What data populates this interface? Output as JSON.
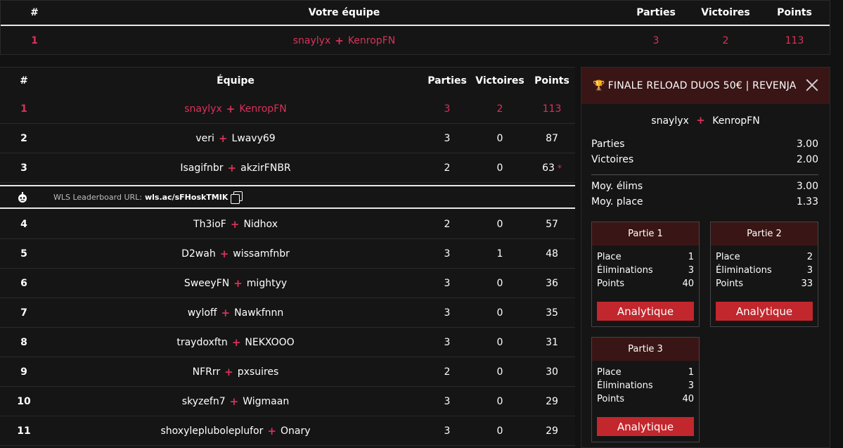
{
  "my_team": {
    "headers": {
      "rank": "#",
      "team": "Votre équipe",
      "games": "Parties",
      "wins": "Victoires",
      "points": "Points"
    },
    "row": {
      "rank": "1",
      "player1": "snaylyx",
      "player2": "KenropFN",
      "games": "3",
      "wins": "2",
      "points": "113"
    }
  },
  "leaderboard": {
    "headers": {
      "rank": "#",
      "team": "Équipe",
      "games": "Parties",
      "wins": "Victoires",
      "points": "Points"
    },
    "rows": [
      {
        "rank": "1",
        "player1": "snaylyx",
        "player2": "KenropFN",
        "games": "3",
        "wins": "2",
        "points": "113"
      },
      {
        "rank": "2",
        "player1": "veri",
        "player2": "Lwavy69",
        "games": "3",
        "wins": "0",
        "points": "87"
      },
      {
        "rank": "3",
        "player1": "Isagifnbr",
        "player2": "akzirFNBR",
        "games": "2",
        "wins": "0",
        "points": "63",
        "marker": "*"
      },
      {
        "rank": "4",
        "player1": "Th3ioF",
        "player2": "Nidhox",
        "games": "2",
        "wins": "0",
        "points": "57"
      },
      {
        "rank": "5",
        "player1": "D2wah",
        "player2": "wissamfnbr",
        "games": "3",
        "wins": "1",
        "points": "48"
      },
      {
        "rank": "6",
        "player1": "SweeyFN",
        "player2": "mightyy",
        "games": "3",
        "wins": "0",
        "points": "36"
      },
      {
        "rank": "7",
        "player1": "wyloff",
        "player2": "Nawkfnnn",
        "games": "3",
        "wins": "0",
        "points": "35"
      },
      {
        "rank": "8",
        "player1": "traydoxftn",
        "player2": "NEKXOOO",
        "games": "3",
        "wins": "0",
        "points": "31"
      },
      {
        "rank": "9",
        "player1": "NFRrr",
        "player2": "pxsuires",
        "games": "2",
        "wins": "0",
        "points": "30"
      },
      {
        "rank": "10",
        "player1": "skyzefn7",
        "player2": "Wigmaan",
        "games": "3",
        "wins": "0",
        "points": "29"
      },
      {
        "rank": "11",
        "player1": "shoxylepluboleplufor",
        "player2": "Onary",
        "games": "3",
        "wins": "0",
        "points": "29"
      }
    ],
    "wls": {
      "label": "WLS Leaderboard URL:",
      "url": "wls.ac/sFHoskTMIK",
      "icon": "robot-icon"
    }
  },
  "panel": {
    "title": "FINALE RELOAD DUOS 50€ | REVENJA",
    "title_icon": "🏆",
    "team": {
      "player1": "snaylyx",
      "player2": "KenropFN"
    },
    "stats": [
      {
        "label": "Parties",
        "value": "3.00"
      },
      {
        "label": "Victoires",
        "value": "2.00"
      },
      {
        "label": "Moy. élims",
        "value": "3.00"
      },
      {
        "label": "Moy. place",
        "value": "1.33"
      }
    ],
    "games": [
      {
        "title": "Partie 1",
        "place_label": "Place",
        "place": "1",
        "elims_label": "Éliminations",
        "elims": "3",
        "points_label": "Points",
        "points": "40",
        "button": "Analytique"
      },
      {
        "title": "Partie 2",
        "place_label": "Place",
        "place": "2",
        "elims_label": "Éliminations",
        "elims": "3",
        "points_label": "Points",
        "points": "33",
        "button": "Analytique"
      },
      {
        "title": "Partie 3",
        "place_label": "Place",
        "place": "1",
        "elims_label": "Éliminations",
        "elims": "3",
        "points_label": "Points",
        "points": "40",
        "button": "Analytique"
      }
    ]
  },
  "colors": {
    "accent": "#d8325a",
    "header_bg": "#3a1515",
    "button": "#c1272d",
    "bg": "#151515"
  }
}
